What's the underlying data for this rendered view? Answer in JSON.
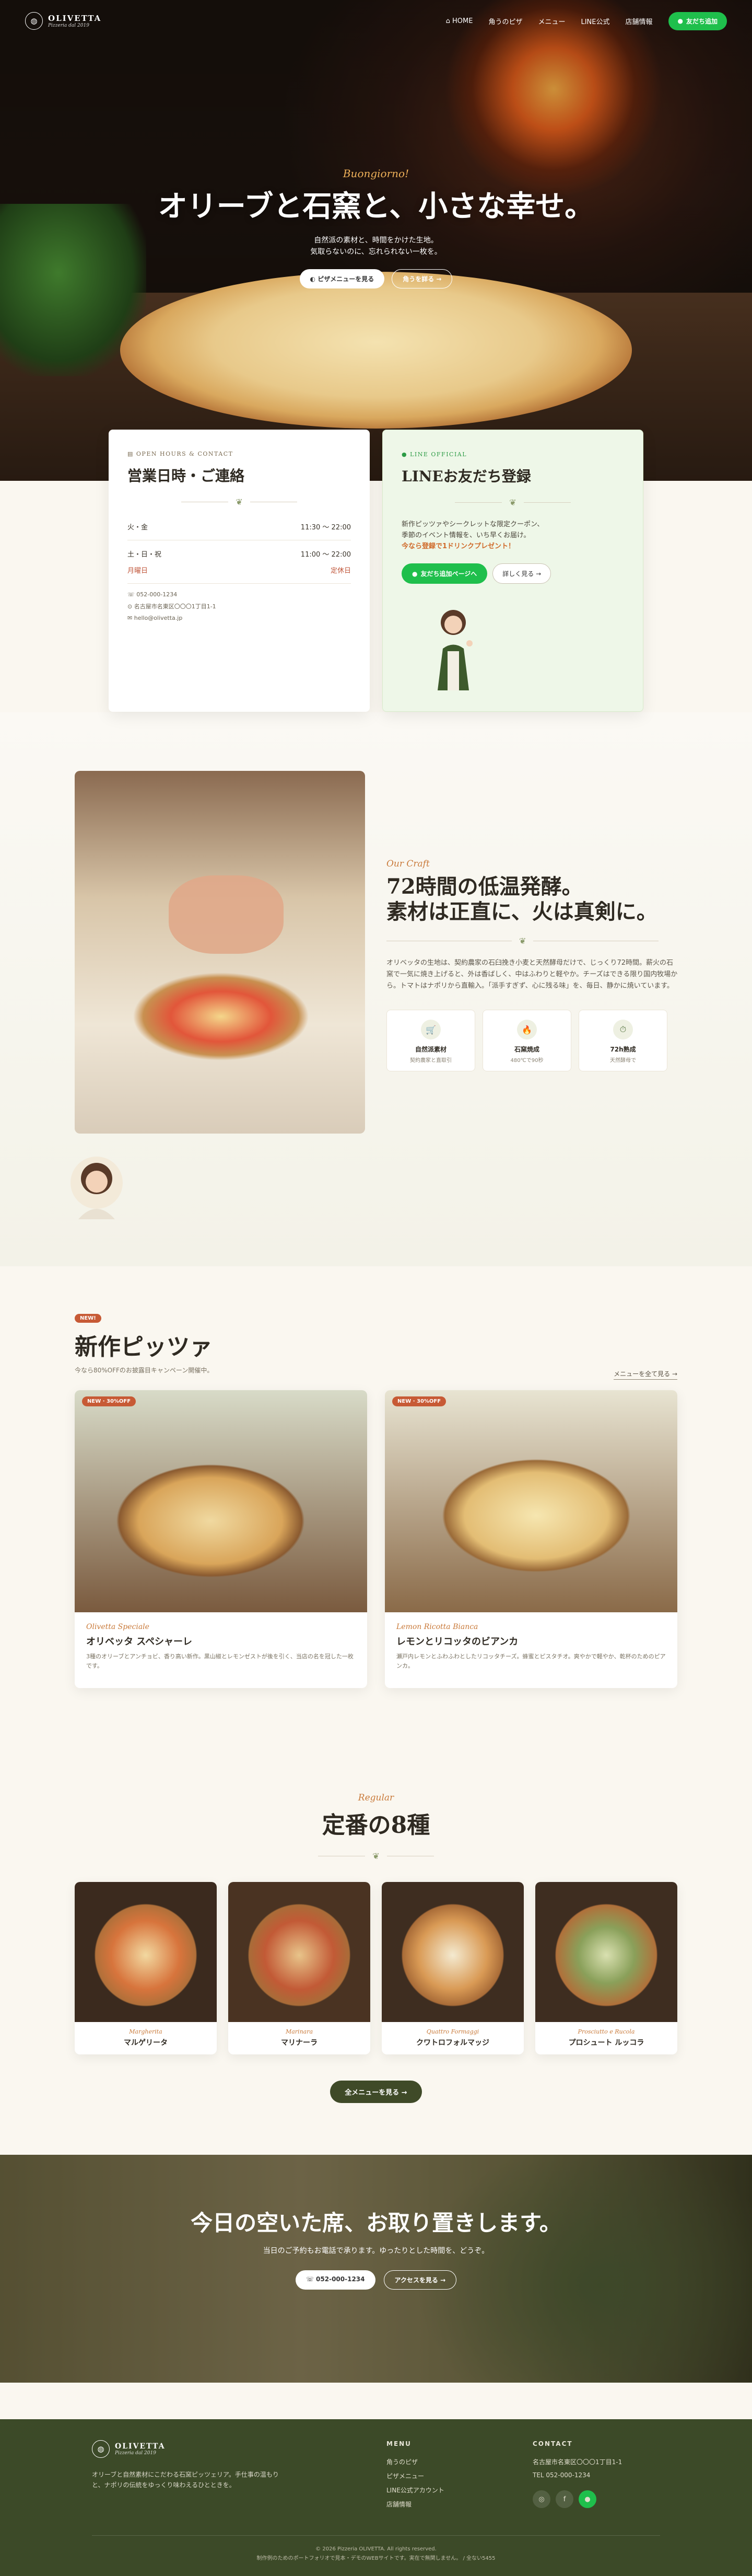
{
  "brand": {
    "name": "OLIVETTA",
    "sub": "Pizzeria dal 2019"
  },
  "nav": {
    "home": "HOME",
    "today": "角うのピザ",
    "menu": "メニュー",
    "line": "LINE公式",
    "store": "店舗情報",
    "cta": "友だち追加"
  },
  "hero": {
    "kicker": "Buongiorno!",
    "title": "オリーブと石窯と、小さな幸せ。",
    "sub1": "自然派の素材と、時間をかけた生地。",
    "sub2": "気取らないのに、忘れられない一枚を。",
    "btn_menu": "ピザメニューを見る",
    "btn_more": "角うを詳る"
  },
  "hours": {
    "kicker": "OPEN HOURS & CONTACT",
    "title": "営業日時・ご連絡",
    "rows": [
      {
        "day": "火・金",
        "time": "11:30 ～ 22:00"
      },
      {
        "day": "土・日・祝",
        "time": "11:00 ～ 22:00"
      },
      {
        "day": "月曜日",
        "time": "定休日"
      }
    ],
    "phone": "052-000-1234",
    "address": "名古屋市名東区〇〇〇1丁目1-1",
    "email": "hello@olivetta.jp"
  },
  "line_card": {
    "kicker": "LINE OFFICIAL",
    "title": "LINEお友だち登録",
    "text1": "新作ピッツァやシークレットな限定クーポン、",
    "text2": "季節のイベント情報を、いち早くお届け。",
    "highlight": "今なら登録で1ドリンクプレゼント！",
    "btn_add": "友だち追加ページへ",
    "btn_more": "詳しく見る"
  },
  "craft": {
    "kicker": "Our Craft",
    "title1": "72時間の低温発酵。",
    "title2": "素材は正直に、火は真剣に。",
    "body": "オリベッタの生地は、契約農家の石臼挽き小麦と天然酵母だけで、じっくり72時間。薪火の石窯で一気に焼き上げると、外は香ばしく、中はふわりと軽やか。チーズはできる限り国内牧場から。トマトはナポリから直輸入。「派手すぎず、心に残る味」を、毎日、静かに焼いています。",
    "features": [
      {
        "icon": "🛒",
        "title": "自然派素材",
        "sub": "契約農家と直取引"
      },
      {
        "icon": "🔥",
        "title": "石窯焼成",
        "sub": "480℃で90秒"
      },
      {
        "icon": "⏱",
        "title": "72h熟成",
        "sub": "天然酵母で"
      }
    ]
  },
  "newsec": {
    "badge": "NEW!",
    "title": "新作ピッツァ",
    "sub": "今なら80%OFFのお披露目キャンペーン開催中。",
    "link": "メニューを全て見る →",
    "items": [
      {
        "badge": "NEW · 30%OFF",
        "kicker": "Olivetta Speciale",
        "name": "オリベッタ スペシャーレ",
        "desc": "3種のオリーブとアンチョビ、香り高い新作。黒山椒とレモンゼストが後を引く、当店の名を冠した一枚です。"
      },
      {
        "badge": "NEW · 30%OFF",
        "kicker": "Lemon Ricotta Bianca",
        "name": "レモンとリコッタのビアンカ",
        "desc": "瀬戸内レモンとふわふわとしたリコッタチーズ。蜂蜜とピスタチオ。爽やかで軽やか、乾杯のためのピアンカ。"
      }
    ]
  },
  "regular": {
    "kicker": "Regular",
    "title": "定番の8種",
    "items": [
      {
        "kicker": "Margherita",
        "name": "マルゲリータ"
      },
      {
        "kicker": "Marinara",
        "name": "マリナーラ"
      },
      {
        "kicker": "Quattro Formaggi",
        "name": "クワトロフォルマッジ"
      },
      {
        "kicker": "Prosciutto e Rucola",
        "name": "プロシュート ルッコラ"
      }
    ],
    "btn": "全メニューを見る →"
  },
  "cta": {
    "title": "今日の空いた席、お取り置きします。",
    "sub": "当日のご予約もお電話で承ります。ゆったりとした時間を、どうぞ。",
    "btn_tel": "052-000-1234",
    "btn_access": "アクセスを見る →"
  },
  "footer": {
    "desc": "オリーブと自然素材にこだわる石窯ピッツェリア。手仕事の温もりと、ナポリの伝統をゆっくり味わえるひとときを。",
    "menu_h": "MENU",
    "menu": [
      "角うのピザ",
      "ピザメニュー",
      "LINE公式アカウント",
      "店舗情報"
    ],
    "contact_h": "CONTACT",
    "contact": [
      "名古屋市名東区〇〇〇1丁目1-1",
      "TEL 052-000-1234"
    ],
    "copy": "© 2026 Pizzeria OLIVETTA. All rights reserved.",
    "note": "制作例のためのポートフォリオで見本・デモのWEBサイトです。実在で無関しません。 / 全ない5455"
  }
}
